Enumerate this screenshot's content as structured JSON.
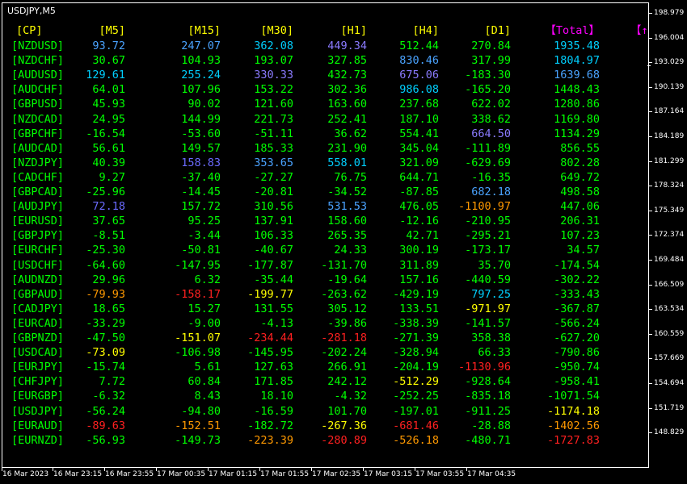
{
  "window": {
    "title": "USDJPY,M5"
  },
  "colors": {
    "header": "#ffff00",
    "total_header": "#ff00ff",
    "pair": "#00ff00",
    "value_default": "#00ff00",
    "cyan": "#00d0ff",
    "blue": "#4aa3ff",
    "lightblue": "#6fb7ff",
    "purple": "#8b7bff",
    "violet": "#6b6bff",
    "orange": "#ff9900",
    "red": "#ff2020",
    "yellow": "#ffff00",
    "white": "#ffffff"
  },
  "table": {
    "headers": [
      "[CP]",
      "[M5]",
      "[M15]",
      "[M30]",
      "[H1]",
      "[H4]",
      "[D1]",
      "【Total】",
      "【↑"
    ],
    "rows": [
      {
        "pair": "[NZDUSD]",
        "m5": "93.72",
        "m15": "247.07",
        "m30": "362.08",
        "h1": "449.34",
        "h4": "512.44",
        "d1": "270.84",
        "total": "1935.48",
        "c": [
          "blue",
          "blue",
          "cyan",
          "purple",
          "value_default",
          "value_default",
          "cyan"
        ]
      },
      {
        "pair": "[NZDCHF]",
        "m5": "30.67",
        "m15": "104.93",
        "m30": "193.07",
        "h1": "327.85",
        "h4": "830.46",
        "d1": "317.99",
        "total": "1804.97",
        "c": [
          "value_default",
          "value_default",
          "value_default",
          "value_default",
          "blue",
          "value_default",
          "cyan"
        ]
      },
      {
        "pair": "[AUDUSD]",
        "m5": "129.61",
        "m15": "255.24",
        "m30": "330.33",
        "h1": "432.73",
        "h4": "675.06",
        "d1": "-183.30",
        "total": "1639.68",
        "c": [
          "cyan",
          "cyan",
          "purple",
          "value_default",
          "purple",
          "value_default",
          "blue"
        ]
      },
      {
        "pair": "[AUDCHF]",
        "m5": "64.01",
        "m15": "107.96",
        "m30": "153.22",
        "h1": "302.36",
        "h4": "986.08",
        "d1": "-165.20",
        "total": "1448.43",
        "c": [
          "value_default",
          "value_default",
          "value_default",
          "value_default",
          "cyan",
          "value_default",
          "value_default"
        ]
      },
      {
        "pair": "[GBPUSD]",
        "m5": "45.93",
        "m15": "90.02",
        "m30": "121.60",
        "h1": "163.60",
        "h4": "237.68",
        "d1": "622.02",
        "total": "1280.86",
        "c": [
          "value_default",
          "value_default",
          "value_default",
          "value_default",
          "value_default",
          "value_default",
          "value_default"
        ]
      },
      {
        "pair": "[NZDCAD]",
        "m5": "24.95",
        "m15": "144.99",
        "m30": "221.73",
        "h1": "252.41",
        "h4": "187.10",
        "d1": "338.62",
        "total": "1169.80",
        "c": [
          "value_default",
          "value_default",
          "value_default",
          "value_default",
          "value_default",
          "value_default",
          "value_default"
        ]
      },
      {
        "pair": "[GBPCHF]",
        "m5": "-16.54",
        "m15": "-53.60",
        "m30": "-51.11",
        "h1": "36.62",
        "h4": "554.41",
        "d1": "664.50",
        "total": "1134.29",
        "c": [
          "value_default",
          "value_default",
          "value_default",
          "value_default",
          "value_default",
          "purple",
          "value_default"
        ]
      },
      {
        "pair": "[AUDCAD]",
        "m5": "56.61",
        "m15": "149.57",
        "m30": "185.33",
        "h1": "231.90",
        "h4": "345.04",
        "d1": "-111.89",
        "total": "856.55",
        "c": [
          "value_default",
          "value_default",
          "value_default",
          "value_default",
          "value_default",
          "value_default",
          "value_default"
        ]
      },
      {
        "pair": "[NZDJPY]",
        "m5": "40.39",
        "m15": "158.83",
        "m30": "353.65",
        "h1": "558.01",
        "h4": "321.09",
        "d1": "-629.69",
        "total": "802.28",
        "c": [
          "value_default",
          "violet",
          "blue",
          "cyan",
          "value_default",
          "value_default",
          "value_default"
        ]
      },
      {
        "pair": "[CADCHF]",
        "m5": "9.27",
        "m15": "-37.40",
        "m30": "-27.27",
        "h1": "76.75",
        "h4": "644.71",
        "d1": "-16.35",
        "total": "649.72",
        "c": [
          "value_default",
          "value_default",
          "value_default",
          "value_default",
          "value_default",
          "value_default",
          "value_default"
        ]
      },
      {
        "pair": "[GBPCAD]",
        "m5": "-25.96",
        "m15": "-14.45",
        "m30": "-20.81",
        "h1": "-34.52",
        "h4": "-87.85",
        "d1": "682.18",
        "total": "498.58",
        "c": [
          "value_default",
          "value_default",
          "value_default",
          "value_default",
          "value_default",
          "blue",
          "value_default"
        ]
      },
      {
        "pair": "[AUDJPY]",
        "m5": "72.18",
        "m15": "157.72",
        "m30": "310.56",
        "h1": "531.53",
        "h4": "476.05",
        "d1": "-1100.97",
        "total": "447.06",
        "c": [
          "violet",
          "value_default",
          "value_default",
          "blue",
          "value_default",
          "orange",
          "value_default"
        ]
      },
      {
        "pair": "[EURUSD]",
        "m5": "37.65",
        "m15": "95.25",
        "m30": "137.91",
        "h1": "158.60",
        "h4": "-12.16",
        "d1": "-210.95",
        "total": "206.31",
        "c": [
          "value_default",
          "value_default",
          "value_default",
          "value_default",
          "value_default",
          "value_default",
          "value_default"
        ]
      },
      {
        "pair": "[GBPJPY]",
        "m5": "-8.51",
        "m15": "-3.44",
        "m30": "106.33",
        "h1": "265.35",
        "h4": "42.71",
        "d1": "-295.21",
        "total": "107.23",
        "c": [
          "value_default",
          "value_default",
          "value_default",
          "value_default",
          "value_default",
          "value_default",
          "value_default"
        ]
      },
      {
        "pair": "[EURCHF]",
        "m5": "-25.30",
        "m15": "-50.81",
        "m30": "-40.67",
        "h1": "24.33",
        "h4": "300.19",
        "d1": "-173.17",
        "total": "34.57",
        "c": [
          "value_default",
          "value_default",
          "value_default",
          "value_default",
          "value_default",
          "value_default",
          "value_default"
        ]
      },
      {
        "pair": "[USDCHF]",
        "m5": "-64.60",
        "m15": "-147.95",
        "m30": "-177.87",
        "h1": "-131.70",
        "h4": "311.89",
        "d1": "35.70",
        "total": "-174.54",
        "c": [
          "value_default",
          "value_default",
          "value_default",
          "value_default",
          "value_default",
          "value_default",
          "value_default"
        ]
      },
      {
        "pair": "[AUDNZD]",
        "m5": "29.96",
        "m15": "6.32",
        "m30": "-35.44",
        "h1": "-19.64",
        "h4": "157.16",
        "d1": "-440.59",
        "total": "-302.22",
        "c": [
          "value_default",
          "value_default",
          "value_default",
          "value_default",
          "value_default",
          "value_default",
          "value_default"
        ]
      },
      {
        "pair": "[GBPAUD]",
        "m5": "-79.93",
        "m15": "-158.17",
        "m30": "-199.77",
        "h1": "-263.62",
        "h4": "-429.19",
        "d1": "797.25",
        "total": "-333.43",
        "c": [
          "orange",
          "red",
          "yellow",
          "value_default",
          "value_default",
          "cyan",
          "value_default"
        ]
      },
      {
        "pair": "[CADJPY]",
        "m5": "18.65",
        "m15": "15.27",
        "m30": "131.55",
        "h1": "305.12",
        "h4": "133.51",
        "d1": "-971.97",
        "total": "-367.87",
        "c": [
          "value_default",
          "value_default",
          "value_default",
          "value_default",
          "value_default",
          "yellow",
          "value_default"
        ]
      },
      {
        "pair": "[EURCAD]",
        "m5": "-33.29",
        "m15": "-9.00",
        "m30": "-4.13",
        "h1": "-39.86",
        "h4": "-338.39",
        "d1": "-141.57",
        "total": "-566.24",
        "c": [
          "value_default",
          "value_default",
          "value_default",
          "value_default",
          "value_default",
          "value_default",
          "value_default"
        ]
      },
      {
        "pair": "[GBPNZD]",
        "m5": "-47.50",
        "m15": "-151.07",
        "m30": "-234.44",
        "h1": "-281.18",
        "h4": "-271.39",
        "d1": "358.38",
        "total": "-627.20",
        "c": [
          "value_default",
          "yellow",
          "red",
          "red",
          "value_default",
          "value_default",
          "value_default"
        ]
      },
      {
        "pair": "[USDCAD]",
        "m5": "-73.09",
        "m15": "-106.98",
        "m30": "-145.95",
        "h1": "-202.24",
        "h4": "-328.94",
        "d1": "66.33",
        "total": "-790.86",
        "c": [
          "yellow",
          "value_default",
          "value_default",
          "value_default",
          "value_default",
          "value_default",
          "value_default"
        ]
      },
      {
        "pair": "[EURJPY]",
        "m5": "-15.74",
        "m15": "5.61",
        "m30": "127.63",
        "h1": "266.91",
        "h4": "-204.19",
        "d1": "-1130.96",
        "total": "-950.74",
        "c": [
          "value_default",
          "value_default",
          "value_default",
          "value_default",
          "value_default",
          "red",
          "value_default"
        ]
      },
      {
        "pair": "[CHFJPY]",
        "m5": "7.72",
        "m15": "60.84",
        "m30": "171.85",
        "h1": "242.12",
        "h4": "-512.29",
        "d1": "-928.64",
        "total": "-958.41",
        "c": [
          "value_default",
          "value_default",
          "value_default",
          "value_default",
          "yellow",
          "value_default",
          "value_default"
        ]
      },
      {
        "pair": "[EURGBP]",
        "m5": "-6.32",
        "m15": "8.43",
        "m30": "18.10",
        "h1": "-4.32",
        "h4": "-252.25",
        "d1": "-835.18",
        "total": "-1071.54",
        "c": [
          "value_default",
          "value_default",
          "value_default",
          "value_default",
          "value_default",
          "value_default",
          "value_default"
        ]
      },
      {
        "pair": "[USDJPY]",
        "m5": "-56.24",
        "m15": "-94.80",
        "m30": "-16.59",
        "h1": "101.70",
        "h4": "-197.01",
        "d1": "-911.25",
        "total": "-1174.18",
        "c": [
          "value_default",
          "value_default",
          "value_default",
          "value_default",
          "value_default",
          "value_default",
          "yellow"
        ]
      },
      {
        "pair": "[EURAUD]",
        "m5": "-89.63",
        "m15": "-152.51",
        "m30": "-182.72",
        "h1": "-267.36",
        "h4": "-681.46",
        "d1": "-28.88",
        "total": "-1402.56",
        "c": [
          "red",
          "orange",
          "value_default",
          "yellow",
          "red",
          "value_default",
          "orange"
        ]
      },
      {
        "pair": "[EURNZD]",
        "m5": "-56.93",
        "m15": "-149.73",
        "m30": "-223.39",
        "h1": "-280.89",
        "h4": "-526.18",
        "d1": "-480.71",
        "total": "-1727.83",
        "c": [
          "value_default",
          "value_default",
          "orange",
          "red",
          "orange",
          "value_default",
          "red"
        ]
      }
    ]
  },
  "price_axis": {
    "labels": [
      "198.979",
      "196.004",
      "193.029",
      "190.139",
      "187.164",
      "184.189",
      "181.299",
      "178.324",
      "175.349",
      "172.374",
      "169.484",
      "166.509",
      "163.534",
      "160.559",
      "157.669",
      "154.694",
      "151.719",
      "148.829"
    ]
  },
  "time_axis": {
    "labels": [
      "16 Mar 2023",
      "16 Mar 23:15",
      "16 Mar 23:55",
      "17 Mar 00:35",
      "17 Mar 01:15",
      "17 Mar 01:55",
      "17 Mar 02:35",
      "17 Mar 03:15",
      "17 Mar 03:55",
      "17 Mar 04:35"
    ]
  }
}
